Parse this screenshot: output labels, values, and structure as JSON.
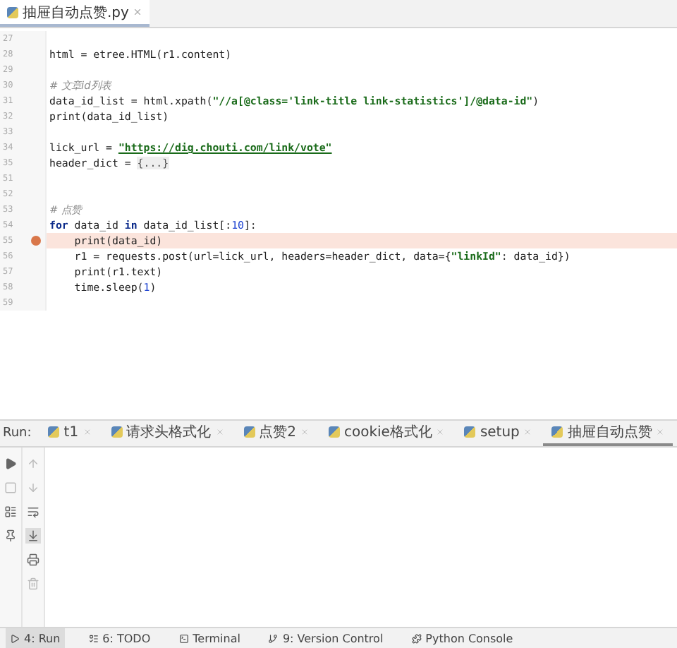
{
  "editor_tab": {
    "label": "抽屉自动点赞.py",
    "selected": true
  },
  "code_lines": [
    {
      "number": "27"
    },
    {
      "number": "28",
      "tokens": [
        {
          "kind": "plain",
          "text": "html = etree.HTML(r1.content)"
        }
      ]
    },
    {
      "number": "29"
    },
    {
      "number": "30",
      "tokens": [
        {
          "kind": "comment",
          "text": "# 文章id列表"
        }
      ]
    },
    {
      "number": "31",
      "tokens": [
        {
          "kind": "plain",
          "text": "data_id_list = html.xpath("
        },
        {
          "kind": "str",
          "text": "\"//a[@class='link-title link-statistics']/@data-id\""
        },
        {
          "kind": "plain",
          "text": ")"
        }
      ]
    },
    {
      "number": "32",
      "tokens": [
        {
          "kind": "plain",
          "text": "print(data_id_list)"
        }
      ]
    },
    {
      "number": "33"
    },
    {
      "number": "34",
      "tokens": [
        {
          "kind": "plain",
          "text": "lick_url = "
        },
        {
          "kind": "link",
          "text": "\"https://dig.chouti.com/link/vote\""
        }
      ]
    },
    {
      "number": "35",
      "tokens": [
        {
          "kind": "plain",
          "text": "header_dict = "
        },
        {
          "kind": "fold",
          "text": "{...}"
        }
      ]
    },
    {
      "number": "51"
    },
    {
      "number": "52"
    },
    {
      "number": "53",
      "tokens": [
        {
          "kind": "comment",
          "text": "# 点赞"
        }
      ]
    },
    {
      "number": "54",
      "tokens": [
        {
          "kind": "kw",
          "text": "for"
        },
        {
          "kind": "plain",
          "text": " data_id "
        },
        {
          "kind": "kw",
          "text": "in"
        },
        {
          "kind": "plain",
          "text": " data_id_list[:"
        },
        {
          "kind": "num",
          "text": "10"
        },
        {
          "kind": "plain",
          "text": "]:"
        }
      ]
    },
    {
      "number": "55",
      "breakpoint": true,
      "tokens": [
        {
          "kind": "plain",
          "text": "    print(data_id)"
        }
      ]
    },
    {
      "number": "56",
      "tokens": [
        {
          "kind": "plain",
          "text": "    r1 = requests.post(url=lick_url, headers=header_dict, data={"
        },
        {
          "kind": "str",
          "text": "\"linkId\""
        },
        {
          "kind": "plain",
          "text": ": data_id})"
        }
      ]
    },
    {
      "number": "57",
      "tokens": [
        {
          "kind": "plain",
          "text": "    print(r1.text)"
        }
      ]
    },
    {
      "number": "58",
      "tokens": [
        {
          "kind": "plain",
          "text": "    time.sleep("
        },
        {
          "kind": "num",
          "text": "1"
        },
        {
          "kind": "plain",
          "text": ")"
        }
      ]
    },
    {
      "number": "59"
    }
  ],
  "run_panel": {
    "label": "Run:",
    "tabs": [
      {
        "label": "t1",
        "selected": false
      },
      {
        "label": "请求头格式化",
        "selected": false
      },
      {
        "label": "点赞2",
        "selected": false
      },
      {
        "label": "cookie格式化",
        "selected": false
      },
      {
        "label": "setup",
        "selected": false
      },
      {
        "label": "抽屉自动点赞",
        "selected": true
      }
    ]
  },
  "status_bar": [
    {
      "label": "4: Run",
      "selected": true
    },
    {
      "label": "6: TODO",
      "selected": false
    },
    {
      "label": "Terminal",
      "selected": false
    },
    {
      "label": "9: Version Control",
      "selected": false
    },
    {
      "label": "Python Console",
      "selected": false
    }
  ]
}
